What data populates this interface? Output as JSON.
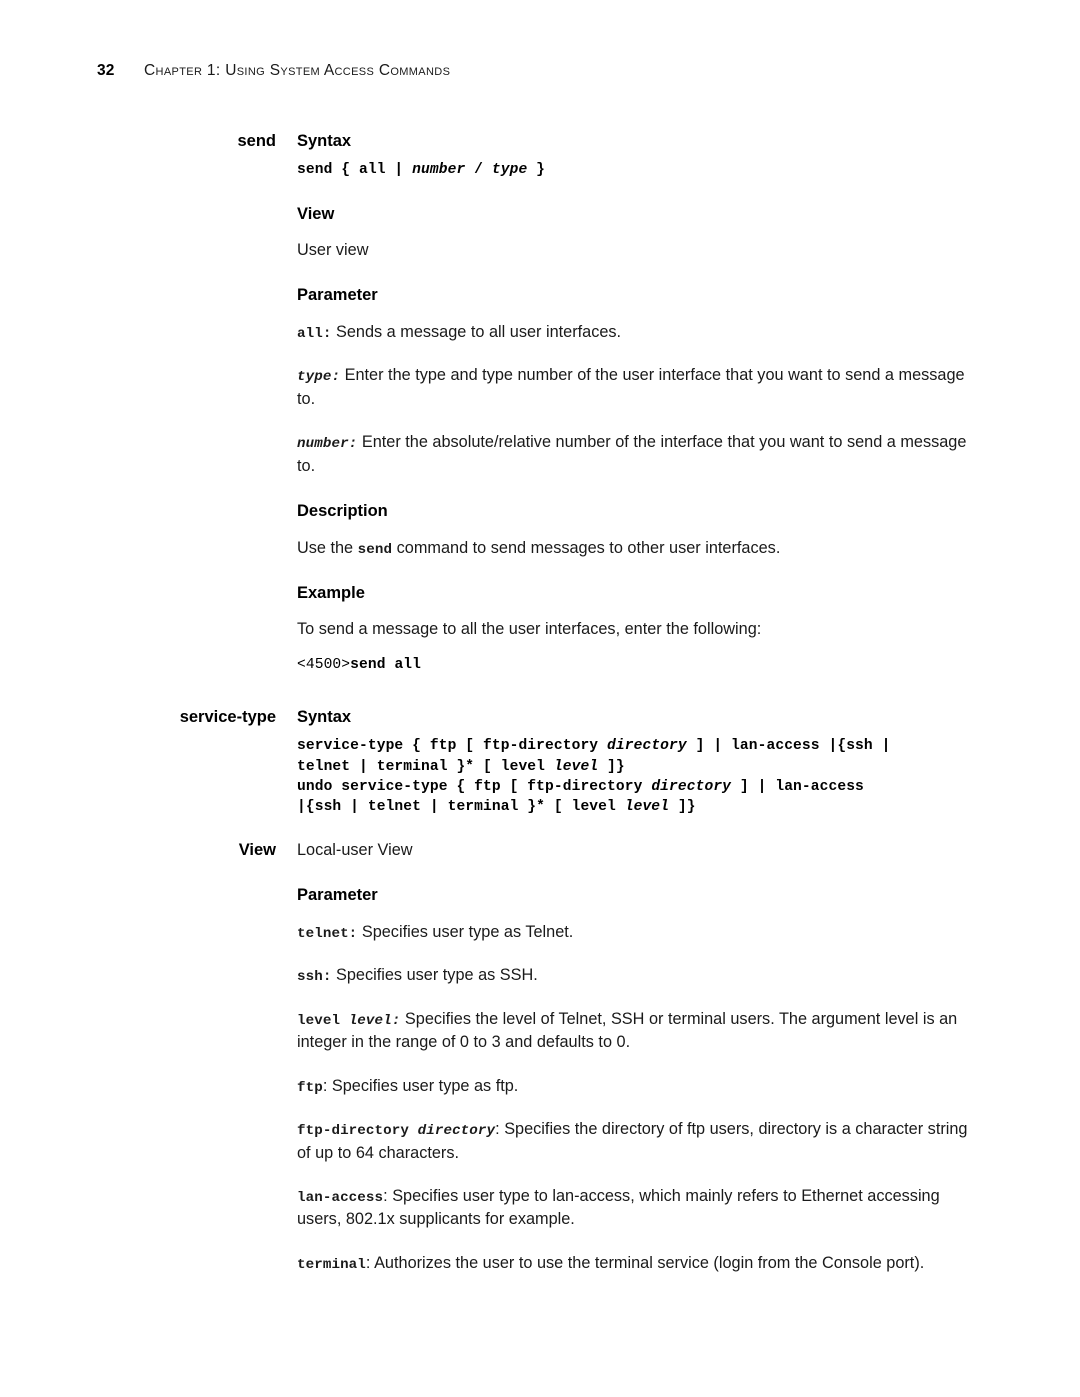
{
  "page": {
    "folio": "32",
    "running_header": "Chapter 1: Using System Access Commands"
  },
  "commands": [
    {
      "name": "send",
      "syntax_heading": "Syntax",
      "syntax_lines": [
        [
          {
            "t": "send { all | ",
            "style": "bold"
          },
          {
            "t": "number",
            "style": "bolditalic"
          },
          {
            "t": " / ",
            "style": "bold"
          },
          {
            "t": "type",
            "style": "bolditalic"
          },
          {
            "t": " }",
            "style": "bold"
          }
        ]
      ],
      "view_heading": "View",
      "view_text": "User view",
      "parameter_heading": "Parameter",
      "parameters": [
        {
          "term": [
            {
              "t": "all:",
              "style": "bold"
            }
          ],
          "desc": " Sends a message to all user interfaces."
        },
        {
          "term": [
            {
              "t": "type:",
              "style": "bolditalic"
            }
          ],
          "desc": " Enter the type and type number of the user interface that you want to send a message to."
        },
        {
          "term": [
            {
              "t": "number:",
              "style": "bolditalic"
            }
          ],
          "desc": " Enter the absolute/relative number of the interface that you want to send a message to."
        }
      ],
      "description_heading": "Description",
      "description_pre": "Use the ",
      "description_code": "send",
      "description_post": " command to send messages to other user interfaces.",
      "example_heading": "Example",
      "example_text": "To send a message to all the user interfaces, enter the following:",
      "example_code": [
        {
          "t": "<4500>",
          "style": "plain"
        },
        {
          "t": "send all",
          "style": "bold"
        }
      ]
    },
    {
      "name": "service-type",
      "syntax_heading": "Syntax",
      "syntax_lines": [
        [
          {
            "t": "service-type { ftp [ ftp-directory ",
            "style": "bold"
          },
          {
            "t": "directory",
            "style": "bolditalic"
          },
          {
            "t": " ] | lan-access |{ssh |",
            "style": "bold"
          }
        ],
        [
          {
            "t": "telnet | terminal }* [ level ",
            "style": "bold"
          },
          {
            "t": "level",
            "style": "bolditalic"
          },
          {
            "t": " ]}",
            "style": "bold"
          }
        ],
        [
          {
            "t": "undo service-type { ftp [ ftp-directory ",
            "style": "bold"
          },
          {
            "t": "directory",
            "style": "bolditalic"
          },
          {
            "t": " ] | lan-access",
            "style": "bold"
          }
        ],
        [
          {
            "t": "|{ssh | telnet | terminal }* [ level ",
            "style": "bold"
          },
          {
            "t": "level",
            "style": "bolditalic"
          },
          {
            "t": " ]}",
            "style": "bold"
          }
        ]
      ],
      "view_label": "View",
      "view_text": "Local-user View",
      "parameter_heading": "Parameter",
      "parameters": [
        {
          "term": [
            {
              "t": "telnet:",
              "style": "bold"
            }
          ],
          "desc": " Specifies user type as Telnet."
        },
        {
          "term": [
            {
              "t": "ssh:",
              "style": "bold"
            }
          ],
          "desc": " Specifies user type as SSH."
        },
        {
          "term": [
            {
              "t": "level ",
              "style": "bold"
            },
            {
              "t": "level:",
              "style": "bolditalic"
            }
          ],
          "desc": " Specifies the level of Telnet, SSH or terminal users. The argument level is an integer in the range of 0 to 3 and defaults to 0."
        },
        {
          "term": [
            {
              "t": "ftp",
              "style": "bold"
            }
          ],
          "desc": ": Specifies user type as ftp."
        },
        {
          "term": [
            {
              "t": "ftp-directory ",
              "style": "bold"
            },
            {
              "t": "directory",
              "style": "bolditalic"
            }
          ],
          "desc": ": Specifies the directory of ftp users, directory is a character string of up to 64 characters."
        },
        {
          "term": [
            {
              "t": "lan-access",
              "style": "bold"
            }
          ],
          "desc": ": Specifies user type to lan-access, which mainly refers to Ethernet accessing users, 802.1x supplicants for example."
        },
        {
          "term": [
            {
              "t": "terminal",
              "style": "bold"
            }
          ],
          "desc": ": Authorizes the user to use the terminal service (login from the Console port)."
        }
      ]
    }
  ]
}
